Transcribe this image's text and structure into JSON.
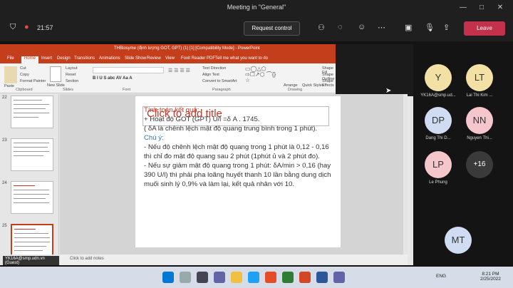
{
  "window": {
    "title": "Meeting in \"General\"",
    "min": "—",
    "max": "□",
    "close": "✕"
  },
  "meeting": {
    "timer": "21:57",
    "request_control": "Request control",
    "leave": "Leave"
  },
  "powerpoint": {
    "title": "THBiosyme (định lượng GOT, GPT) (1) [1] [Compatibility Mode] - PowerPoint",
    "tabs": [
      "File",
      "Home",
      "Insert",
      "Design",
      "Transitions",
      "Animations",
      "Slide Show",
      "Review",
      "View",
      "Foxit Reader PDF"
    ],
    "tell_me": "Tell me what you want to do",
    "ribbon": {
      "cut": "Cut",
      "copy": "Copy",
      "format_painter": "Format Painter",
      "paste": "Paste",
      "new_slide": "New Slide",
      "layout": "Layout",
      "reset": "Reset",
      "section": "Section",
      "text_direction": "Text Direction",
      "align_text": "Align Text",
      "convert_smartart": "Convert to SmartArt",
      "arrange": "Arrange",
      "quick_styles": "Quick Styles",
      "shape_fill": "Shape Fill",
      "shape_outline": "Shape Outline",
      "shape_effects": "Shape Effects",
      "groups": {
        "clipboard": "Clipboard",
        "slides": "Slides",
        "font": "Font",
        "paragraph": "Paragraph",
        "drawing": "Drawing"
      }
    },
    "thumbs": [
      {
        "num": "22"
      },
      {
        "num": "23"
      },
      {
        "num": "24"
      },
      {
        "num": "25"
      }
    ],
    "slide": {
      "title_placeholder": "Click to add title",
      "line1": "Tính toán kết quả:",
      "line2": "+ Hoạt độ GOT (GPT) U/l =δ A . 1745.",
      "line3": "( δA là chênh lệch mật độ quang trung bình trong 1 phút).",
      "line4": "Chú ý:",
      "line5": "- Nếu độ chênh lệch mật độ quang trong 1 phút là 0,12 - 0,16 thì chỉ đo mật độ quang sau 2 phút (1phút ủ và 2 phút đo).",
      "line6": "- Nếu sự giảm mật độ quang trong 1 phút: δA/min > 0,16 (hay 390 U/l) thì phải pha loãng huyết thanh 10 lần bằng dung dịch muối sinh lý 0,9% và làm lại, kết quả nhân với 10."
    },
    "notes": "Click to add notes",
    "guest_label": "YK16A@smp.udn.vn (Guest)"
  },
  "participants": [
    {
      "initials": "Y",
      "name": "YK16A@smp.ud...",
      "color": "#f3e0a4"
    },
    {
      "initials": "LT",
      "name": "Lai Thi Kim ...",
      "color": "#f3e0a4"
    },
    {
      "initials": "DP",
      "name": "Dang Thi D...",
      "color": "#cfdcf2"
    },
    {
      "initials": "NN",
      "name": "Nguyen Thi...",
      "color": "#f5c6cb"
    },
    {
      "initials": "LP",
      "name": "Le Phung",
      "color": "#f5c6cb"
    },
    {
      "initials": "+16",
      "name": "",
      "color": "#3a3a3a"
    },
    {
      "initials": "MT",
      "name": "",
      "color": "#cfdcf2"
    }
  ],
  "taskbar": {
    "lang": "ENG",
    "time": "8:21 PM",
    "date": "2/25/2022"
  }
}
